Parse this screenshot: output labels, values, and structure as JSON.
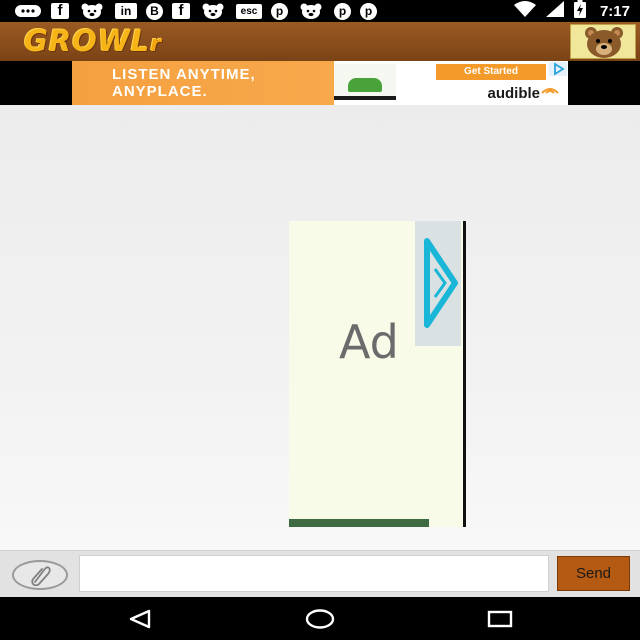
{
  "status_bar": {
    "time": "7:17",
    "notifications": [
      {
        "icon": "chat-bubble-icon"
      },
      {
        "icon": "facebook-icon",
        "glyph": "f"
      },
      {
        "icon": "growl-bear-icon"
      },
      {
        "icon": "linkedin-icon",
        "glyph": "in"
      },
      {
        "icon": "b-circle-icon",
        "glyph": "B"
      },
      {
        "icon": "facebook-icon",
        "glyph": "f"
      },
      {
        "icon": "growl-bear-icon"
      },
      {
        "icon": "esc-icon",
        "glyph": "esc"
      },
      {
        "icon": "pinterest-icon",
        "glyph": "p"
      },
      {
        "icon": "growl-bear-icon"
      },
      {
        "icon": "pinterest-icon",
        "glyph": "p"
      },
      {
        "icon": "pinterest-icon",
        "glyph": "p"
      }
    ],
    "system_icons": [
      "wifi-icon",
      "cell-signal-icon",
      "battery-charging-icon"
    ]
  },
  "header": {
    "logo_text": "GROWL",
    "logo_suffix": "r"
  },
  "banner_ad": {
    "line1": "LISTEN ANYTIME,",
    "line2": "ANYPLACE.",
    "cta": "Get Started",
    "brand": "audible",
    "colors": {
      "orange": "#f5a040"
    }
  },
  "content_ad": {
    "label": "Ad"
  },
  "composer": {
    "message_value": "",
    "send_label": "Send"
  },
  "colors": {
    "header_brown": "#8a4c1c",
    "logo_gold": "#f6b418",
    "send_button": "#b55a12"
  }
}
